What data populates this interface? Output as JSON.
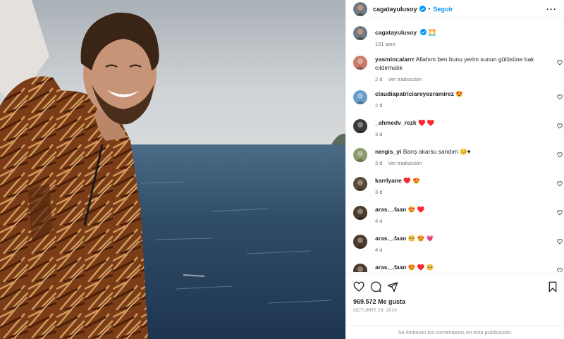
{
  "post": {
    "username": "cagatayulusoy",
    "follow_label": "Seguir",
    "dot": "•",
    "more": "···",
    "caption_emoji": "🌅",
    "time_ago": "131 sem"
  },
  "comments": [
    {
      "user": "yasmincalarrr",
      "text": "Allahım ben bunu yerim sunun gülüsüne bak cıldırmalık",
      "age": "2 d",
      "translate": "Ver traducción",
      "avatar_color": "#c97b6a"
    },
    {
      "user": "claudiapatriciareyesramirez",
      "text": "😍",
      "age": "2 d",
      "translate": "",
      "avatar_color": "#6a9cc9"
    },
    {
      "user": "_ahmedv_rezk",
      "text": "♥️ ♥️",
      "age": "3 d",
      "translate": "",
      "avatar_color": "#3a3a3a"
    },
    {
      "user": "nergis_yi",
      "text": "Barış akarsu sandım 😊♥",
      "age": "3 d",
      "translate": "Ver traducción",
      "avatar_color": "#8a9a6a"
    },
    {
      "user": "karrlyane",
      "text": "♥️ 😍",
      "age": "3 d",
      "translate": "",
      "avatar_color": "#5a4a3a"
    },
    {
      "user": "aras._.faan",
      "text": "😍 ♥️",
      "age": "4 d",
      "translate": "",
      "avatar_color": "#4a3a2a"
    },
    {
      "user": "aras._.faan",
      "text": "🥺 😍 💗",
      "age": "4 d",
      "translate": "",
      "avatar_color": "#4a3a2a"
    },
    {
      "user": "aras._.faan",
      "text": "😍 ♥️ 🥺",
      "age": "",
      "translate": "",
      "avatar_color": "#4a3a2a"
    }
  ],
  "actions": {
    "likes": "969.572 Me gusta",
    "date": "OCTUBRE 29, 2020"
  },
  "footer": {
    "limited": "Se limitaron los comentarios en esta publicación."
  },
  "colors": {
    "accent": "#0095f6",
    "verified": "#0095f6",
    "sea": "#3d5a72",
    "sky": "#c9ced3",
    "jacket": "#8b4a22"
  }
}
